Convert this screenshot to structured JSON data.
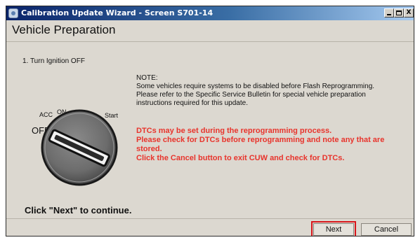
{
  "window": {
    "title": "Calibration Update Wizard - Screen S701-14",
    "controls": {
      "minimize": "_",
      "close": "X"
    }
  },
  "header": {
    "title": "Vehicle Preparation"
  },
  "step": {
    "text": "1. Turn Ignition OFF"
  },
  "note": {
    "heading": "NOTE:",
    "lines": [
      "Some vehicles require systems to be disabled before Flash Reprogramming.",
      "Please refer to the Specific Service Bulletin for special vehicle preparation",
      "instructions required for this update."
    ]
  },
  "warning": {
    "lines": [
      "DTCs may be set during the reprogramming process.",
      "Please check for DTCs before reprogramming and note any that are",
      "stored.",
      "Click the Cancel button to exit CUW and check for DTCs."
    ],
    "color": "#e8342c"
  },
  "ignition": {
    "positions": {
      "on": "ON",
      "acc": "ACC",
      "start": "Start",
      "off": "OFF"
    },
    "icon": "ignition-key-switch-icon"
  },
  "footer": {
    "instruction": "Click \"Next\" to continue.",
    "buttons": {
      "next": "Next",
      "cancel": "Cancel"
    },
    "highlight_color": "#d8161b"
  },
  "colors": {
    "title_bar": "#0a246a",
    "background": "#dcd8d0"
  }
}
